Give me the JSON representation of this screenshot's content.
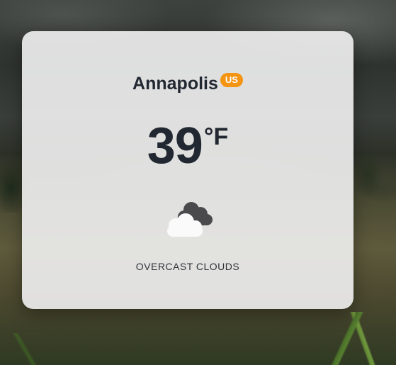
{
  "weather_card": {
    "city": "Annapolis",
    "country_code": "US",
    "temperature": "39",
    "unit": "°F",
    "condition": "OVERCAST CLOUDS",
    "icon": "overcast-clouds-icon"
  },
  "colors": {
    "badge": "#f39412",
    "text": "#222831",
    "card_background": "#eeeeee"
  }
}
